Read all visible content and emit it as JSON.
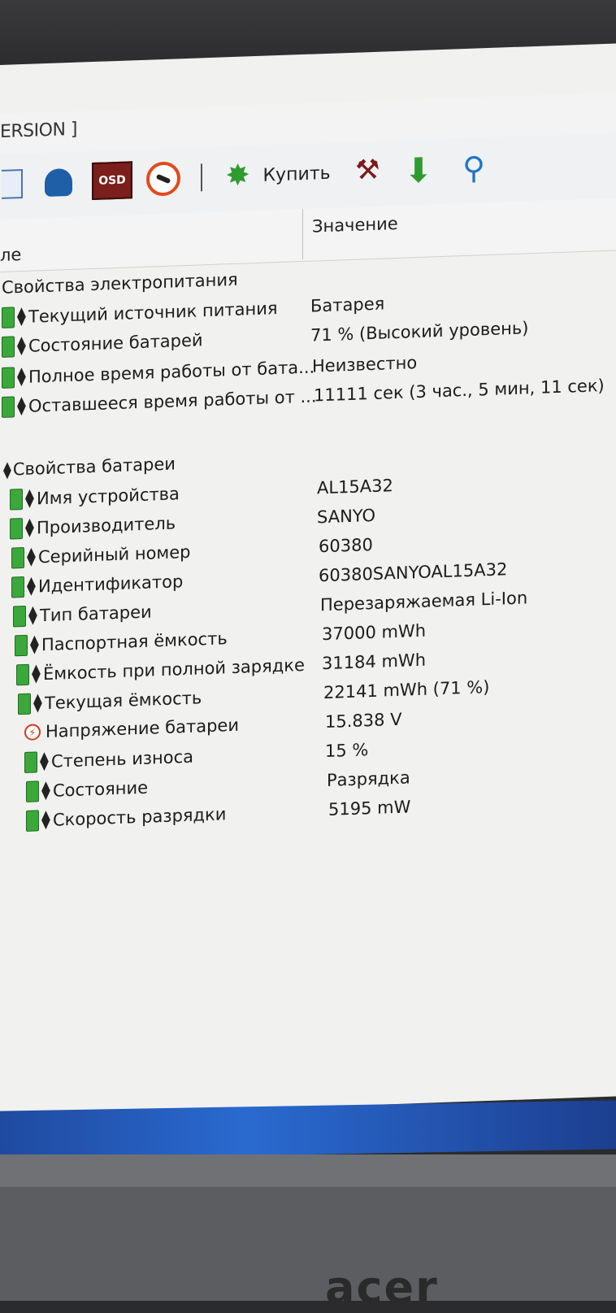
{
  "window": {
    "title_fragment": "ERSION ]"
  },
  "toolbar": {
    "osd_label": "OSD",
    "buy_label": "Купить"
  },
  "table": {
    "col_field": "ле",
    "col_value": "Значение"
  },
  "power": {
    "section_title": "Свойства электропитания",
    "rows": [
      {
        "field": "Текущий источник питания",
        "value": "Батарея"
      },
      {
        "field": "Состояние батарей",
        "value": "71 % (Высокий уровень)"
      },
      {
        "field": "Полное время работы от бата...",
        "value": "Неизвестно"
      },
      {
        "field": "Оставшееся время работы от ...",
        "value": "11111 сек (3 час., 5 мин, 11 сек)"
      }
    ]
  },
  "battery": {
    "section_title": "Свойства батареи",
    "rows": [
      {
        "field": "Имя устройства",
        "value": "AL15A32"
      },
      {
        "field": "Производитель",
        "value": "SANYO"
      },
      {
        "field": "Серийный номер",
        "value": "60380"
      },
      {
        "field": "Идентификатор",
        "value": "60380SANYOAL15A32"
      },
      {
        "field": "Тип батареи",
        "value": "Перезаряжаемая Li-Ion"
      },
      {
        "field": "Паспортная ёмкость",
        "value": "37000 mWh"
      },
      {
        "field": "Ёмкость при полной зарядке",
        "value": "31184 mWh"
      },
      {
        "field": "Текущая ёмкость",
        "value": "22141 mWh  (71 %)"
      },
      {
        "field": "Напряжение батареи",
        "value": "15.838 V"
      },
      {
        "field": "Степень износа",
        "value": "15 %"
      },
      {
        "field": "Состояние",
        "value": "Разрядка"
      },
      {
        "field": "Скорость разрядки",
        "value": "5195 mW"
      }
    ]
  },
  "bezel": {
    "brand": "acer"
  }
}
